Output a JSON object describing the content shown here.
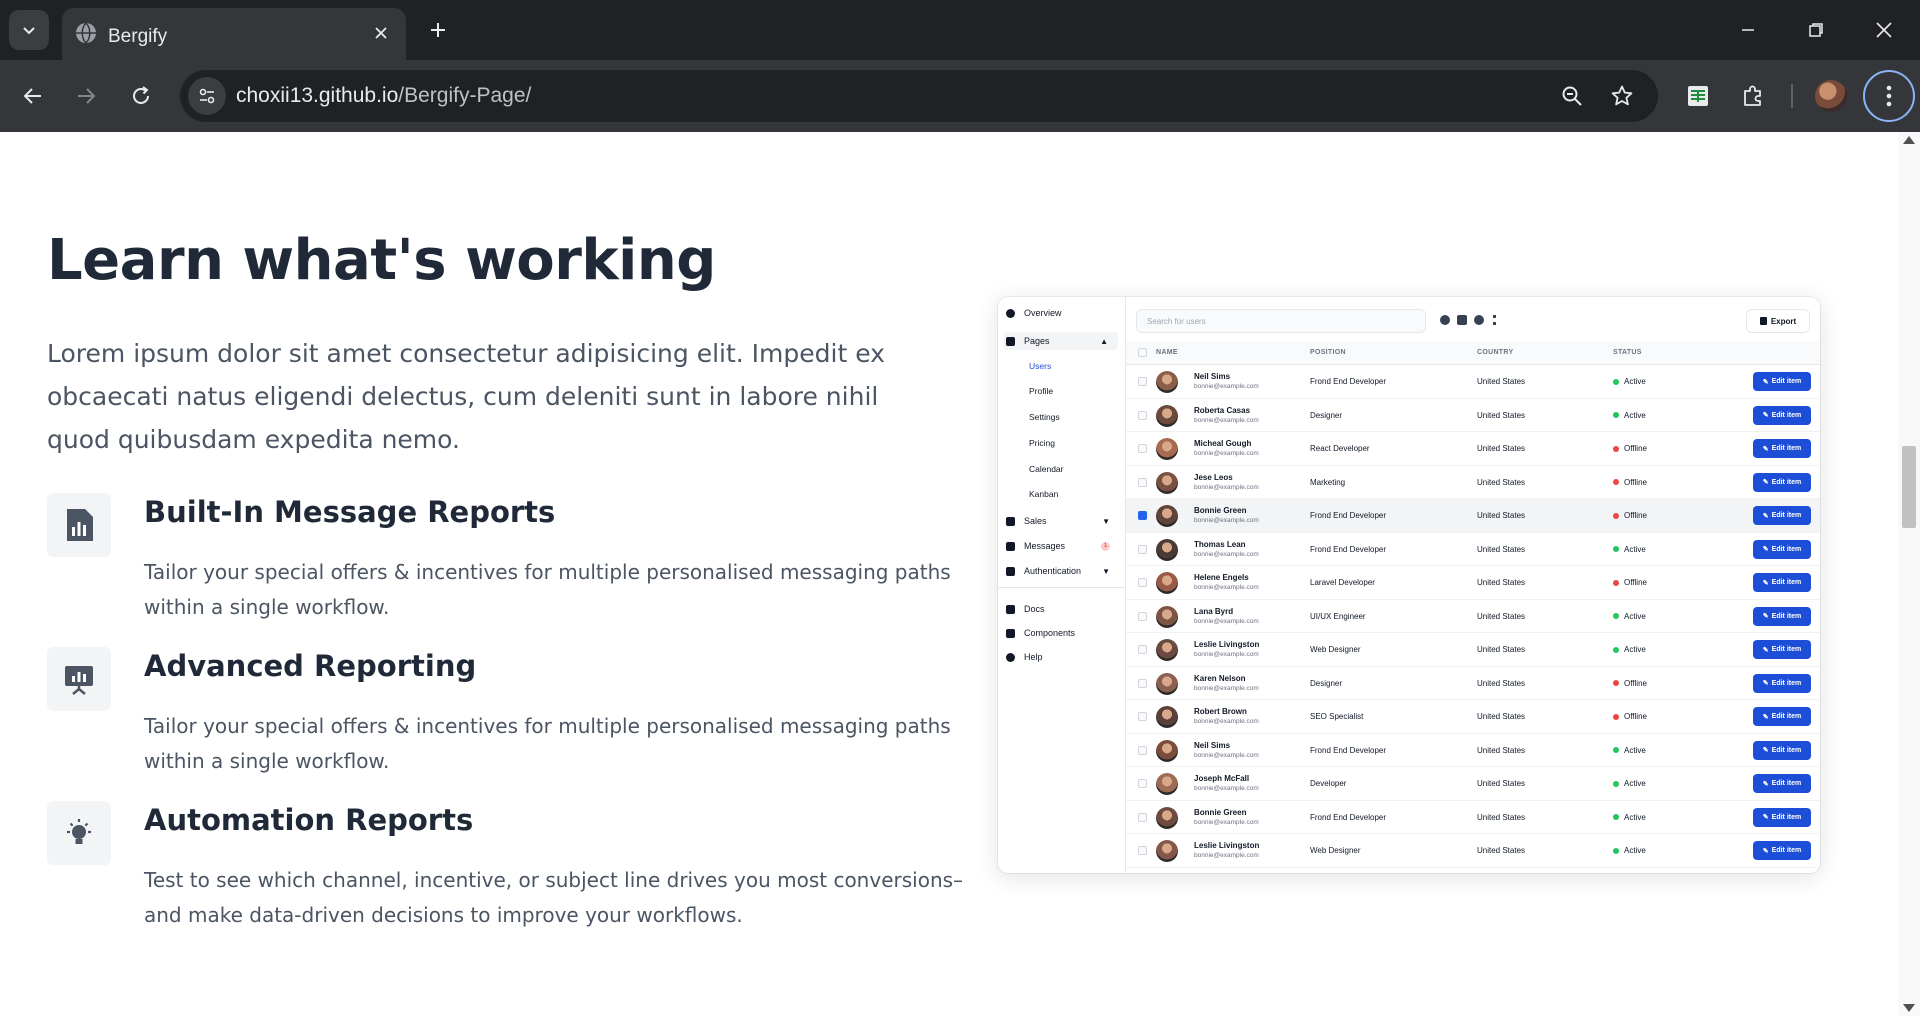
{
  "browser": {
    "tab_title": "Bergify",
    "url_host": "choxii13.github.io",
    "url_path": "/Bergify-Page/"
  },
  "page": {
    "heading": "Learn what's working",
    "lead": "Lorem ipsum dolor sit amet consectetur adipisicing elit. Impedit ex obcaecati natus eligendi delectus, cum deleniti sunt in labore nihil quod quibusdam expedita nemo.",
    "features": [
      {
        "icon": "bar-chart-icon",
        "title": "Built-In Message Reports",
        "desc": "Tailor your special offers & incentives for multiple personalised messaging paths within a single workflow."
      },
      {
        "icon": "presentation-chart-icon",
        "title": "Advanced Reporting",
        "desc": "Tailor your special offers & incentives for multiple personalised messaging paths within a single workflow."
      },
      {
        "icon": "lightbulb-icon",
        "title": "Automation Reports",
        "desc": "Test to see which channel, incentive, or subject line drives you most conversions–and make data-driven decisions to improve your workflows."
      }
    ]
  },
  "mockup": {
    "sidebar": {
      "overview": "Overview",
      "pages": "Pages",
      "sub": [
        "Users",
        "Profile",
        "Settings",
        "Pricing",
        "Calendar",
        "Kanban"
      ],
      "sales": "Sales",
      "messages": "Messages",
      "messages_badge": "1",
      "authentication": "Authentication",
      "docs": "Docs",
      "components": "Components",
      "help": "Help"
    },
    "search_placeholder": "Search for users",
    "export_label": "Export",
    "columns": [
      "NAME",
      "POSITION",
      "COUNTRY",
      "STATUS"
    ],
    "edit_label": "Edit item",
    "status_colors": {
      "Active": "#22c55e",
      "Offline": "#ef4444"
    },
    "accent": "#1d4ed8",
    "rows": [
      {
        "name": "Neil Sims",
        "email": "bonnie@example.com",
        "position": "Frond End Developer",
        "country": "United States",
        "status": "Active"
      },
      {
        "name": "Roberta Casas",
        "email": "bonnie@example.com",
        "position": "Designer",
        "country": "United States",
        "status": "Active"
      },
      {
        "name": "Micheal Gough",
        "email": "bonnie@example.com",
        "position": "React Developer",
        "country": "United States",
        "status": "Offline"
      },
      {
        "name": "Jese Leos",
        "email": "bonnie@example.com",
        "position": "Marketing",
        "country": "United States",
        "status": "Offline"
      },
      {
        "name": "Bonnie Green",
        "email": "bonnie@example.com",
        "position": "Frond End Developer",
        "country": "United States",
        "status": "Offline",
        "selected": true
      },
      {
        "name": "Thomas Lean",
        "email": "bonnie@example.com",
        "position": "Frond End Developer",
        "country": "United States",
        "status": "Active"
      },
      {
        "name": "Helene Engels",
        "email": "bonnie@example.com",
        "position": "Laravel Developer",
        "country": "United States",
        "status": "Offline"
      },
      {
        "name": "Lana Byrd",
        "email": "bonnie@example.com",
        "position": "UI/UX Engineer",
        "country": "United States",
        "status": "Active"
      },
      {
        "name": "Leslie Livingston",
        "email": "bonnie@example.com",
        "position": "Web Designer",
        "country": "United States",
        "status": "Active"
      },
      {
        "name": "Karen Nelson",
        "email": "bonnie@example.com",
        "position": "Designer",
        "country": "United States",
        "status": "Offline"
      },
      {
        "name": "Robert Brown",
        "email": "bonnie@example.com",
        "position": "SEO Specialist",
        "country": "United States",
        "status": "Offline"
      },
      {
        "name": "Neil Sims",
        "email": "bonnie@example.com",
        "position": "Frond End Developer",
        "country": "United States",
        "status": "Active"
      },
      {
        "name": "Joseph McFall",
        "email": "bonnie@example.com",
        "position": "Developer",
        "country": "United States",
        "status": "Active"
      },
      {
        "name": "Bonnie Green",
        "email": "bonnie@example.com",
        "position": "Frond End Developer",
        "country": "United States",
        "status": "Active"
      },
      {
        "name": "Leslie Livingston",
        "email": "bonnie@example.com",
        "position": "Web Designer",
        "country": "United States",
        "status": "Active"
      }
    ]
  }
}
